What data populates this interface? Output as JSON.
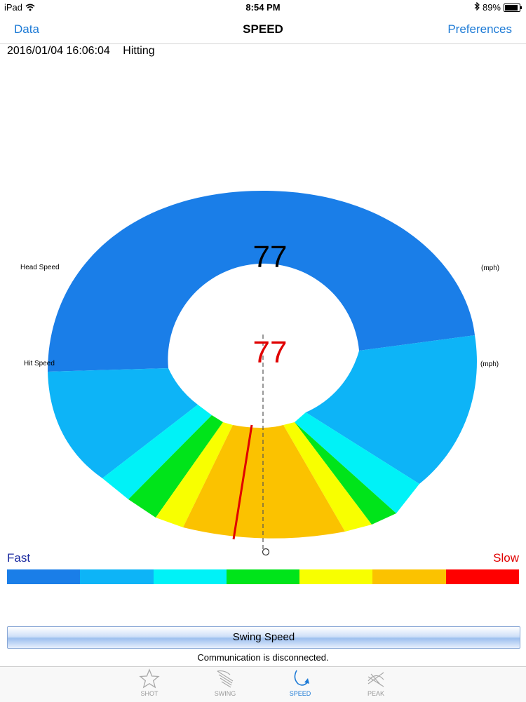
{
  "status_bar": {
    "device": "iPad",
    "time": "8:54 PM",
    "battery": "89%",
    "battery_level": 0.89
  },
  "nav": {
    "left": "Data",
    "title": "SPEED",
    "right": "Preferences"
  },
  "session": {
    "datetime": "2016/01/04 16:06:04",
    "mode": "Hitting"
  },
  "gauge": {
    "head_speed_label": "Head Speed",
    "head_speed_value": "77",
    "head_speed_unit": "(mph)",
    "hit_speed_label": "Hit Speed",
    "hit_speed_value": "77",
    "hit_speed_unit": "(mph)",
    "head_value_color": "#000000",
    "hit_value_color": "#e00000"
  },
  "scale": {
    "fast_label": "Fast",
    "slow_label": "Slow",
    "colors": [
      "#1a7ee8",
      "#0db4f7",
      "#00f2f7",
      "#00e41a",
      "#f8ff00",
      "#fbc200",
      "#ff0000"
    ]
  },
  "swing_speed_button": "Swing Speed",
  "communication_status": "Communication is disconnected.",
  "tabs": [
    {
      "label": "SHOT",
      "icon": "star-icon",
      "active": false
    },
    {
      "label": "SWING",
      "icon": "swing-lines-icon",
      "active": false
    },
    {
      "label": "SPEED",
      "icon": "speed-arrow-icon",
      "active": true
    },
    {
      "label": "PEAK",
      "icon": "peak-graph-icon",
      "active": false
    }
  ]
}
